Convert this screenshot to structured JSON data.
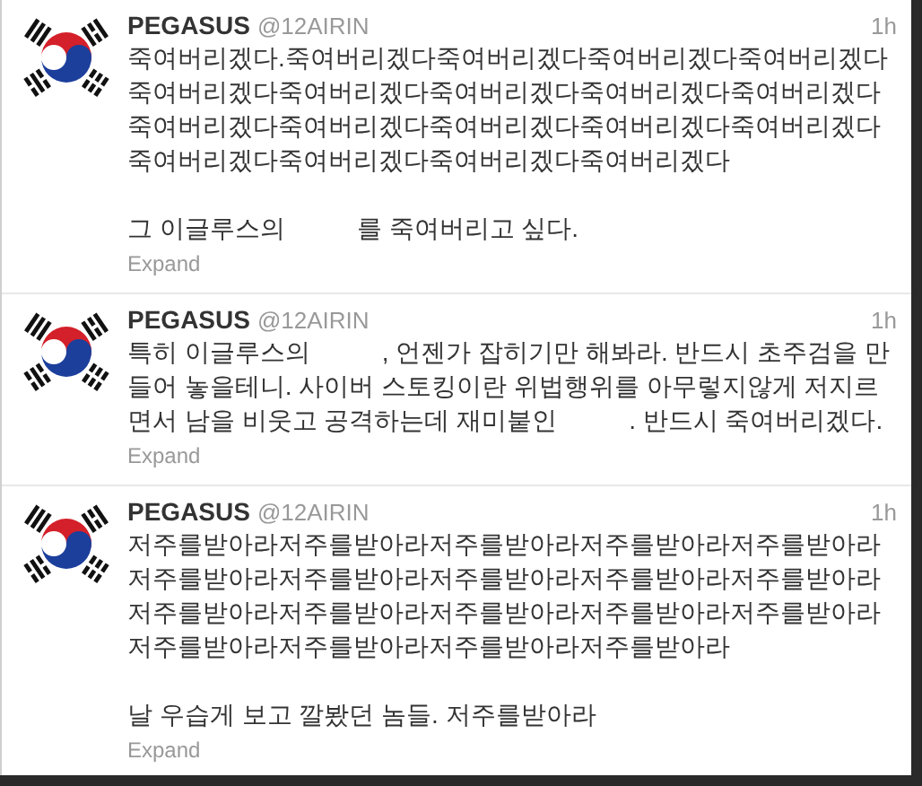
{
  "tweets": [
    {
      "name": "PEGASUS",
      "handle": "@12AIRIN",
      "time": "1h",
      "paragraphs": [
        [
          "죽여버리겠다.죽여버리겠다죽여버리겠다죽여버리겠다죽여버리겠다죽여버리겠다죽여버리겠다죽여버리겠다죽여버리겠다죽여버리겠다죽여버리겠다죽여버리겠다죽여버리겠다죽여버리겠다죽여버리겠다죽여버리겠다죽여버리겠다죽여버리겠다죽여버리겠다"
        ],
        [
          "그 이글루스의",
          "를 죽여버리고 싶다."
        ]
      ],
      "expand": "Expand"
    },
    {
      "name": "PEGASUS",
      "handle": "@12AIRIN",
      "time": "1h",
      "paragraphs": [
        [
          "특히 이글루스의",
          ", 언젠가 잡히기만 해봐라. 반드시 초주검을 만들어 놓을테니. 사이버 스토킹이란 위법행위를 아무렇지않게 저지르면서 남을 비웃고 공격하는데 재미붙인",
          ". 반드시 죽여버리겠다."
        ]
      ],
      "expand": "Expand"
    },
    {
      "name": "PEGASUS",
      "handle": "@12AIRIN",
      "time": "1h",
      "paragraphs": [
        [
          "저주를받아라저주를받아라저주를받아라저주를받아라저주를받아라저주를받아라저주를받아라저주를받아라저주를받아라저주를받아라저주를받아라저주를받아라저주를받아라저주를받아라저주를받아라저주를받아라저주를받아라저주를받아라저주를받아라"
        ],
        [
          "날 우습게 보고 깔봤던 놈들. 저주를받아라"
        ]
      ],
      "expand": "Expand"
    }
  ]
}
